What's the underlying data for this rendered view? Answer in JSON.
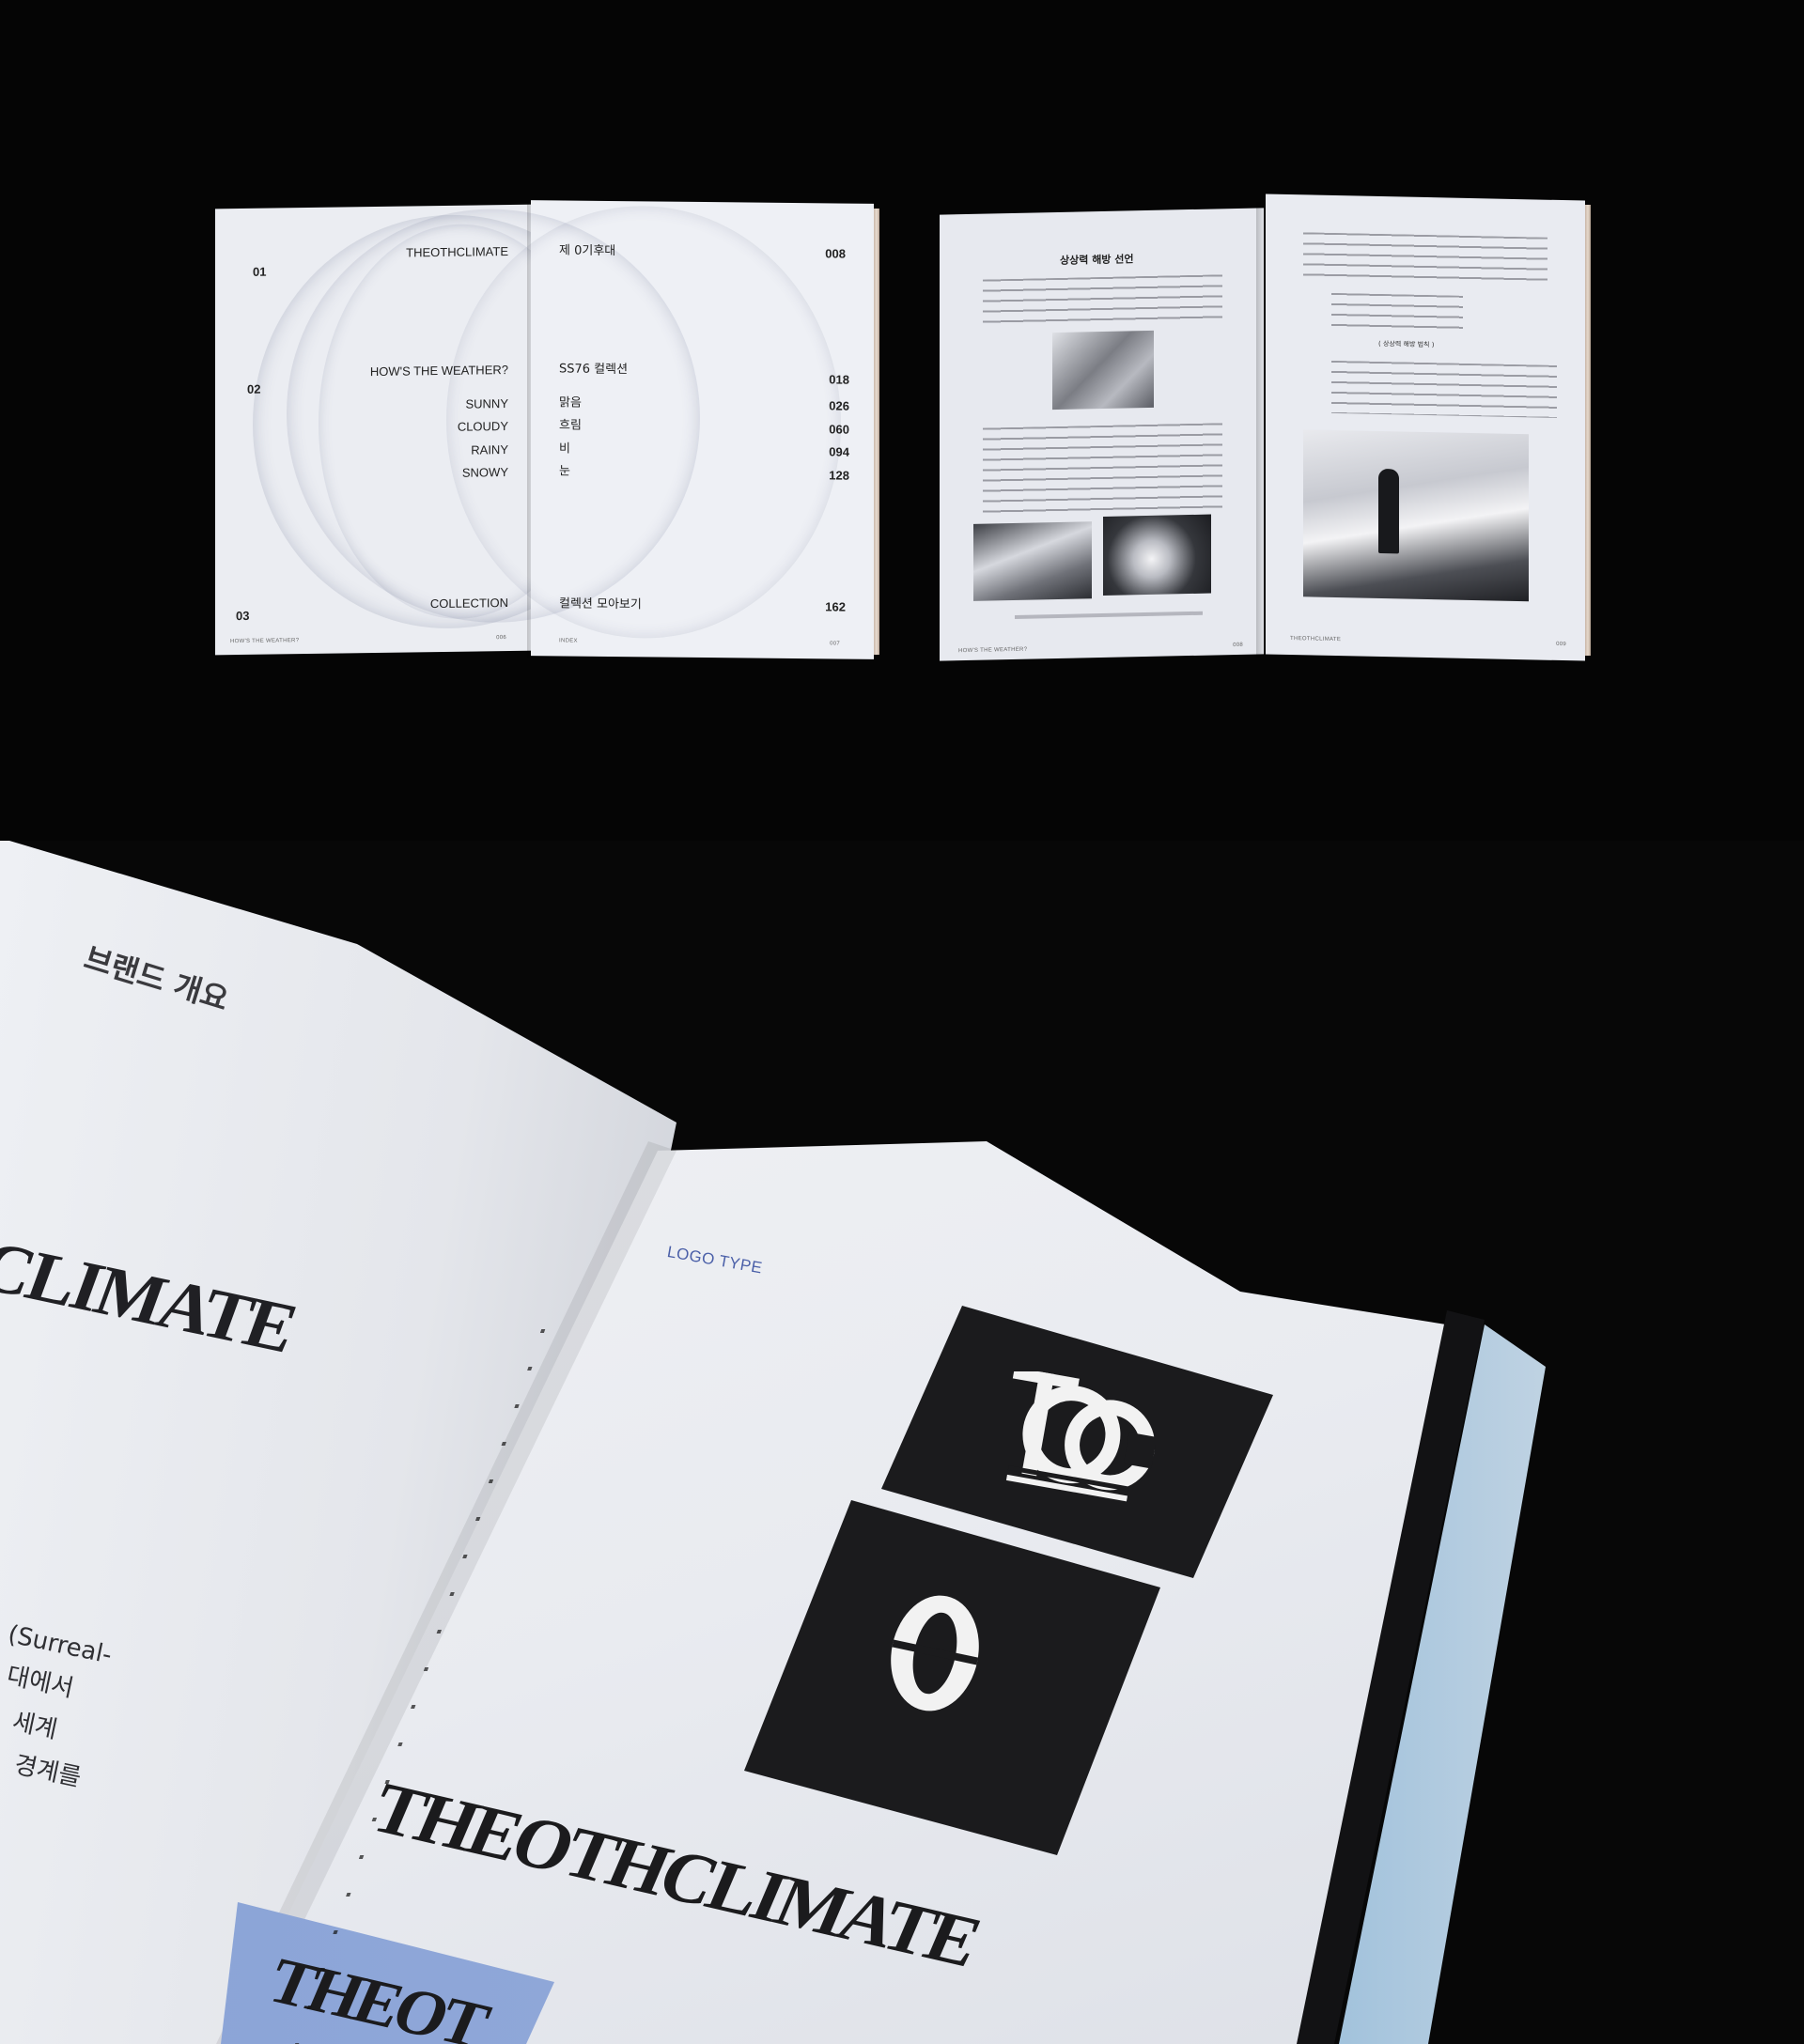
{
  "spread1": {
    "left": {
      "brand": "THEOTHCLIMATE",
      "weather": "HOW'S THE WEATHER?",
      "items": [
        "SUNNY",
        "CLOUDY",
        "RAINY",
        "SNOWY"
      ],
      "collection": "COLLECTION",
      "section_numbers": [
        "01",
        "02",
        "03"
      ],
      "footer_left": "HOW'S THE WEATHER?",
      "footer_right": "006"
    },
    "right": {
      "title": "제 0기후대",
      "collection_title": "SS76 컬렉션",
      "items": [
        "맑음",
        "흐림",
        "비",
        "눈"
      ],
      "collection": "컬렉션 모아보기",
      "page_numbers": [
        "008",
        "018",
        "026",
        "060",
        "094",
        "128",
        "162"
      ],
      "footer_left": "INDEX",
      "footer_right": "007"
    }
  },
  "spread2": {
    "left": {
      "title": "상상력 해방 선언",
      "footer_left": "HOW'S THE WEATHER?",
      "footer_right": "008"
    },
    "right": {
      "subtitle": "( 상상력 해방 법칙 )",
      "footer_left": "THEOTHCLIMATE",
      "footer_right": "009"
    }
  },
  "spread3": {
    "left": {
      "heading": "브랜드 개요",
      "wordmark_fragment": "CLIMATE",
      "body_lines": [
        "(Surreal-",
        "대에서",
        "세계",
        "경계를"
      ]
    },
    "right": {
      "label": "LOGO TYPE",
      "wordmark": "THEOTHCLIMATE",
      "wordmark_fragment": "THEOT"
    }
  },
  "colors": {
    "background": "#050505",
    "paper": "#eceef3",
    "accent_blue": "#8fa7d8",
    "logo_black": "#1b1b1d"
  }
}
